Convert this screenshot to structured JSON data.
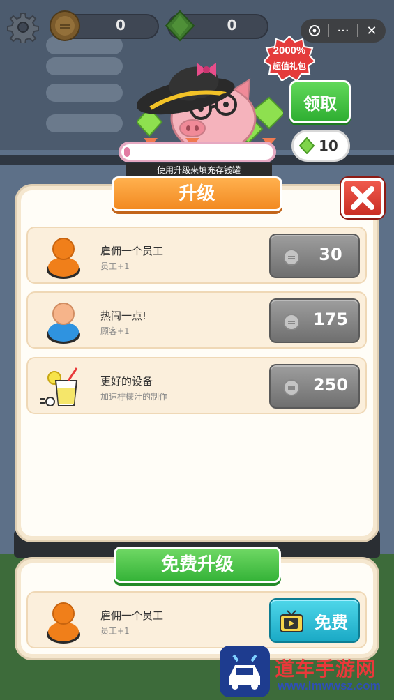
{
  "hud": {
    "coins": "0",
    "gems": "0"
  },
  "miniapp_bar": {
    "icons": [
      "record-icon",
      "more-icon",
      "close-icon"
    ],
    "more_label": "···",
    "close_label": "✕"
  },
  "piggy_bank": {
    "badge_percent": "2000%",
    "badge_label": "超值礼包",
    "claim_label": "领取",
    "gem_reward": "10",
    "caption": "使用升级来填充存钱罐",
    "progress": 0.02
  },
  "upgrade_panel": {
    "title": "升级",
    "close_label": "X",
    "items": [
      {
        "title": "雇佣一个员工",
        "subtitle": "员工+1",
        "price": "30",
        "icon": "employee-orange-icon"
      },
      {
        "title": "热闹一点!",
        "subtitle": "顾客+1",
        "price": "175",
        "icon": "customer-blue-icon"
      },
      {
        "title": "更好的设备",
        "subtitle": "加速柠檬汁的制作",
        "price": "250",
        "icon": "lemonade-icon"
      }
    ]
  },
  "free_panel": {
    "title": "免费升级",
    "item": {
      "title": "雇佣一个员工",
      "subtitle": "员工+1",
      "button_label": "免费",
      "icon": "employee-orange-icon"
    }
  },
  "watermark": {
    "title": "道车手游网",
    "url": "www.lmwwsz.com"
  },
  "colors": {
    "panel_bg": "#fffdf7",
    "row_bg": "#fbefdc",
    "orange_ribbon": "#f28a21",
    "green_ribbon": "#35b338",
    "close_red": "#c92d23",
    "price_gray": "#6f6f6f",
    "free_cyan": "#1aa9c5"
  }
}
